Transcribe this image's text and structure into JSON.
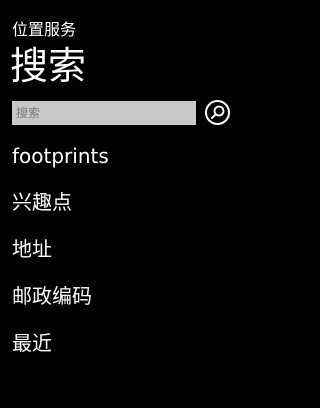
{
  "header": {
    "app_title": "位置服务",
    "page_title": "搜索"
  },
  "search": {
    "placeholder": "搜索",
    "value": "",
    "button_icon": "search-icon"
  },
  "menu": {
    "items": [
      {
        "label": "footprints"
      },
      {
        "label": "兴趣点"
      },
      {
        "label": "地址"
      },
      {
        "label": "邮政编码"
      },
      {
        "label": "最近"
      }
    ]
  },
  "colors": {
    "background": "#000000",
    "foreground": "#ffffff",
    "search_field": "#c8c8c8"
  }
}
